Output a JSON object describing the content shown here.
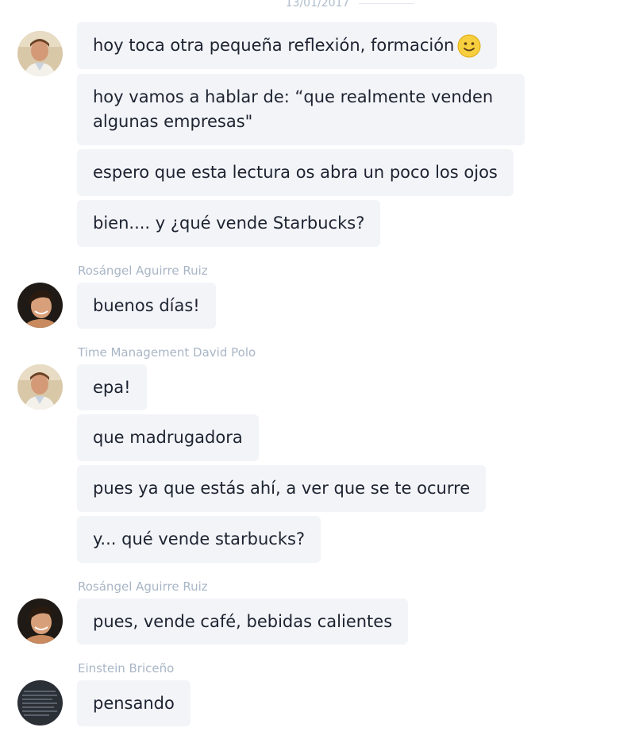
{
  "date_separator": "13/01/2017",
  "messages": [
    {
      "text": "hoy toca otra pequeña reflexión, formación"
    },
    {
      "text": "hoy vamos a hablar de: “que realmente venden algunas empresas\""
    },
    {
      "text": "espero que esta lectura os abra un poco los ojos"
    },
    {
      "text": "bien.... y ¿qué vende Starbucks?"
    },
    {
      "text": "buenos días!"
    },
    {
      "text": "epa!"
    },
    {
      "text": "que madrugadora"
    },
    {
      "text": "pues ya que estás ahí, a ver que se te ocurre"
    },
    {
      "text": "y... qué vende starbucks?"
    },
    {
      "text": "pues, vende café, bebidas calientes"
    },
    {
      "text": "pensando"
    }
  ],
  "senders": [
    "Rosángel Aguirre Ruiz",
    "Time Management David Polo",
    "Rosángel Aguirre Ruiz",
    "Einstein Briceño"
  ],
  "icons": {
    "emoji": "smiley-emoji-icon"
  }
}
